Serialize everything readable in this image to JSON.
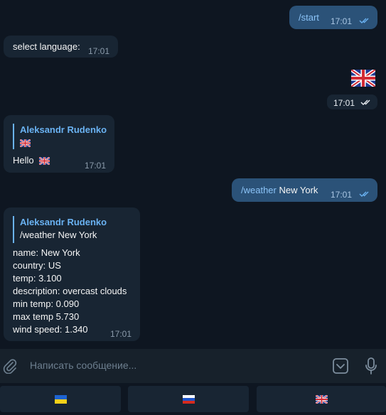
{
  "messages": {
    "start": {
      "command": "/start",
      "time": "17:01"
    },
    "select_language": {
      "text": "select language:",
      "time": "17:01"
    },
    "flag_sticker_time": "17:01",
    "reply1": {
      "author": "Aleksandr Rudenko",
      "quoted_text": "🇬🇧",
      "text": "Hello",
      "time": "17:01"
    },
    "weather_cmd": {
      "command": "/weather",
      "argument": " New York",
      "time": "17:01"
    },
    "weather_reply": {
      "author": "Aleksandr Rudenko",
      "quoted_text": "/weather New York",
      "lines": [
        "name: New York",
        "country: US",
        "temp: 3.100",
        "description: overcast clouds",
        "min temp: 0.090",
        "max temp 5.730",
        "wind speed: 1.340"
      ],
      "time": "17:01"
    }
  },
  "composer": {
    "placeholder": "Написать сообщение..."
  },
  "keyboard": {
    "buttons": [
      "ukraine-flag",
      "russia-flag",
      "uk-flag"
    ]
  },
  "colors": {
    "background": "#0e1621",
    "incoming_bubble": "#182533",
    "outgoing_bubble": "#2b5278",
    "accent": "#6ab2f2"
  }
}
